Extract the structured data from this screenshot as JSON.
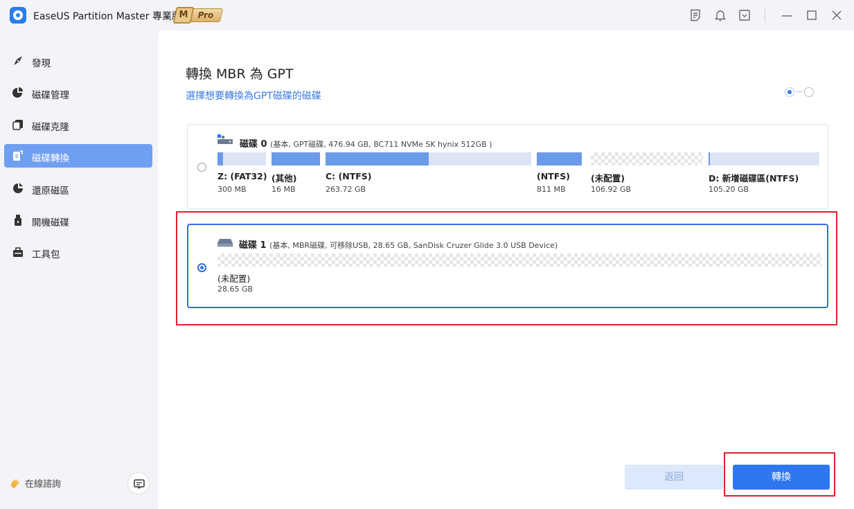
{
  "app": {
    "title": "EaseUS Partition Master 專業版",
    "badge_m": "M",
    "badge_pro": "Pro"
  },
  "sidebar": {
    "items": [
      {
        "label": "發現",
        "icon": "compass-icon",
        "active": false
      },
      {
        "label": "磁碟管理",
        "icon": "pie-chart-icon",
        "active": false
      },
      {
        "label": "磁碟克隆",
        "icon": "clone-icon",
        "active": false
      },
      {
        "label": "磁碟轉換",
        "icon": "convert-icon",
        "active": true
      },
      {
        "label": "還原磁區",
        "icon": "recover-icon",
        "active": false
      },
      {
        "label": "開機磁碟",
        "icon": "usb-icon",
        "active": false
      },
      {
        "label": "工具包",
        "icon": "toolbox-icon",
        "active": false
      }
    ],
    "consult_label": "在線諮詢"
  },
  "main": {
    "title": "轉換 MBR 為 GPT",
    "subtitle": "選擇想要轉換為GPT磁碟的磁碟",
    "disks": [
      {
        "name": "磁碟 0",
        "info": "(基本, GPT磁碟, 476.94 GB, BC711 NVMe SK hynix 512GB )",
        "selected": false,
        "partitions": [
          {
            "label": "Z: (FAT32)",
            "size": "300 MB",
            "fill": 0.12,
            "type": "used"
          },
          {
            "label": "(其他)",
            "size": "16 MB",
            "fill": 1.0,
            "type": "used"
          },
          {
            "label": "C: (NTFS)",
            "size": "263.72 GB",
            "fill": 0.5,
            "type": "used"
          },
          {
            "label": "(NTFS)",
            "size": "811 MB",
            "fill": 1.0,
            "type": "used"
          },
          {
            "label": "(未配置)",
            "size": "106.92 GB",
            "fill": 0,
            "type": "unallocated"
          },
          {
            "label": "D: 新增磁碟區(NTFS)",
            "size": "105.20 GB",
            "fill": 0.01,
            "type": "used"
          }
        ]
      },
      {
        "name": "磁碟 1",
        "info": "(基本, MBR磁碟, 可移除USB, 28.65 GB, SanDisk Cruzer Glide 3.0 USB Device)",
        "selected": true,
        "partitions": [
          {
            "label": "(未配置)",
            "size": "28.65 GB",
            "fill": 0,
            "type": "unallocated"
          }
        ]
      }
    ]
  },
  "buttons": {
    "back": "返回",
    "convert": "轉換"
  },
  "colors": {
    "accent": "#2f77ee",
    "partition_fill": "#6b9ae8",
    "partition_bg": "#dde5f4",
    "highlight": "#e0202a",
    "sidebar_active": "#6f9ff0"
  }
}
